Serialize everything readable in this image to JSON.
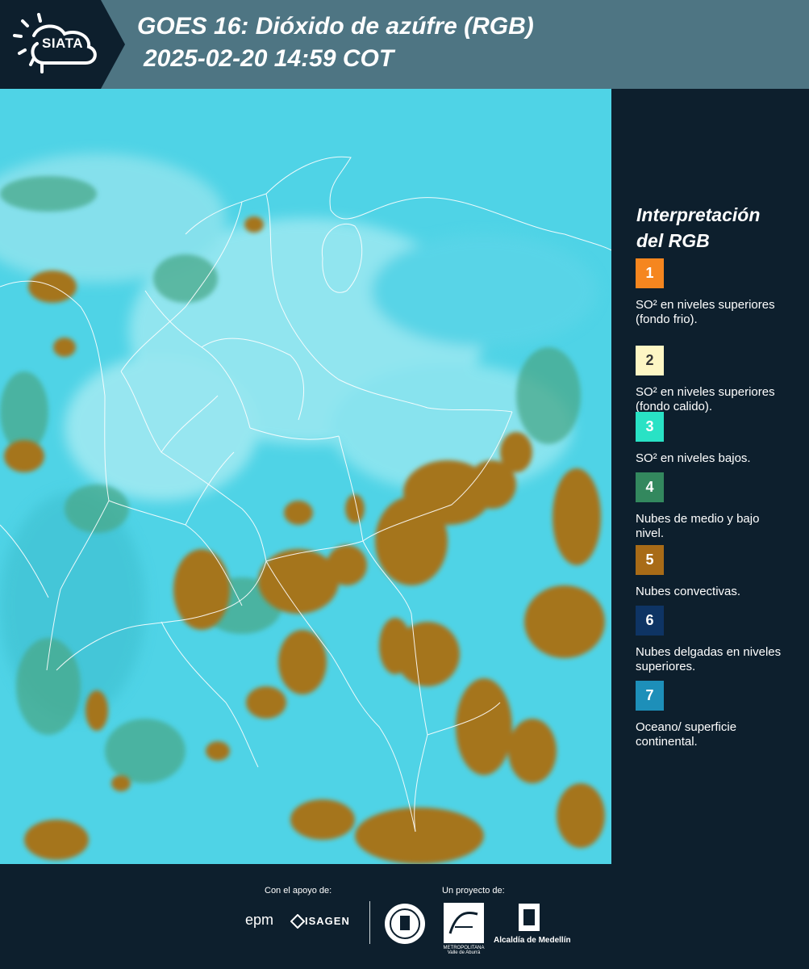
{
  "header": {
    "logo_text": "SIATA",
    "title_line1": "GOES 16: Dióxido de azúfre (RGB)",
    "title_line2": "2025-02-20 14:59 COT"
  },
  "map": {
    "ocean_color": "#4fd3e6",
    "cloud_color": "#a5741f",
    "border_color": "#ffffff"
  },
  "legend": {
    "title_line1": "Interpretación",
    "title_line2": "del RGB",
    "items": [
      {
        "number": "1",
        "color": "#f5861f",
        "text_color": "#ffffff",
        "label": "SO² en niveles superiores (fondo frio)."
      },
      {
        "number": "2",
        "color": "#fdf6c4",
        "text_color": "#333333",
        "label": "SO² en niveles superiores (fondo calido)."
      },
      {
        "number": "3",
        "color": "#29e2c5",
        "text_color": "#ffffff",
        "label": "SO² en niveles bajos."
      },
      {
        "number": "4",
        "color": "#33885e",
        "text_color": "#ffffff",
        "label": "Nubes de medio y bajo nivel."
      },
      {
        "number": "5",
        "color": "#a86b17",
        "text_color": "#ffffff",
        "label": "Nubes convectivas."
      },
      {
        "number": "6",
        "color": "#0e3464",
        "text_color": "#ffffff",
        "label": "Nubes delgadas en niveles superiores."
      },
      {
        "number": "7",
        "color": "#1d8fb9",
        "text_color": "#ffffff",
        "label": "Oceano/ superficie continental."
      }
    ]
  },
  "footer": {
    "support_label": "Con el apoyo de:",
    "project_label": "Un proyecto de:",
    "sponsor1": "epm",
    "sponsor2": "ISAGEN",
    "partner_area": "METROPOLITANA Valle de Aburrá",
    "partner_alcaldia": "Alcaldía de Medellín"
  }
}
